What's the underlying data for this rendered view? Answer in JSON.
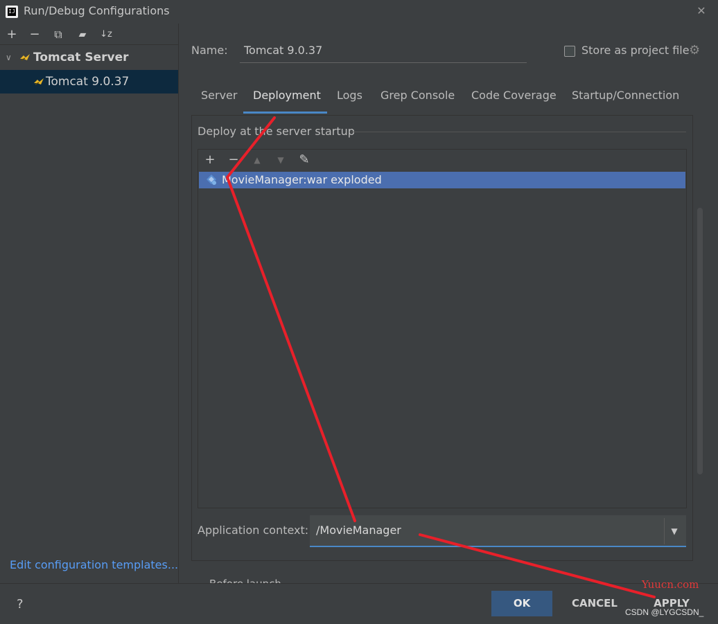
{
  "window": {
    "title": "Run/Debug Configurations",
    "close": "✕"
  },
  "left_toolbar": {
    "add": "+",
    "remove": "−",
    "copy": "⧉",
    "folder": "▰",
    "sort": "↓z"
  },
  "tree": {
    "group_label": "Tomcat Server",
    "item_label": "Tomcat 9.0.37"
  },
  "left_footer": {
    "edit_templates": "Edit configuration templates..."
  },
  "config": {
    "name_label": "Name:",
    "name_value": "Tomcat 9.0.37",
    "store_label": "Store as project file",
    "store_checked": false
  },
  "tabs": [
    {
      "label": "Server"
    },
    {
      "label": "Deployment",
      "active": true
    },
    {
      "label": "Logs"
    },
    {
      "label": "Grep Console"
    },
    {
      "label": "Code Coverage"
    },
    {
      "label": "Startup/Connection"
    }
  ],
  "deployment": {
    "heading": "Deploy at the server startup",
    "toolbar": {
      "add": "+",
      "remove": "−",
      "up": "▲",
      "down": "▼",
      "edit": "✎"
    },
    "artifacts": [
      {
        "label": "MovieManager:war exploded",
        "selected": true
      }
    ],
    "context_label": "Application context:",
    "context_value": "/MovieManager",
    "partial_label": "Before launch"
  },
  "footer": {
    "help": "?",
    "ok": "OK",
    "cancel": "CANCEL",
    "apply": "APPLY"
  },
  "watermarks": {
    "site": "Yuucn.com",
    "author": "CSDN @LYGCSDN_"
  },
  "colors": {
    "background": "#3c3f41",
    "selection": "#4b6eaf",
    "tree_selection": "#0d293e",
    "accent": "#4a88c7",
    "ok_button": "#365880",
    "link": "#589df6",
    "annotation": "#e8202a"
  }
}
